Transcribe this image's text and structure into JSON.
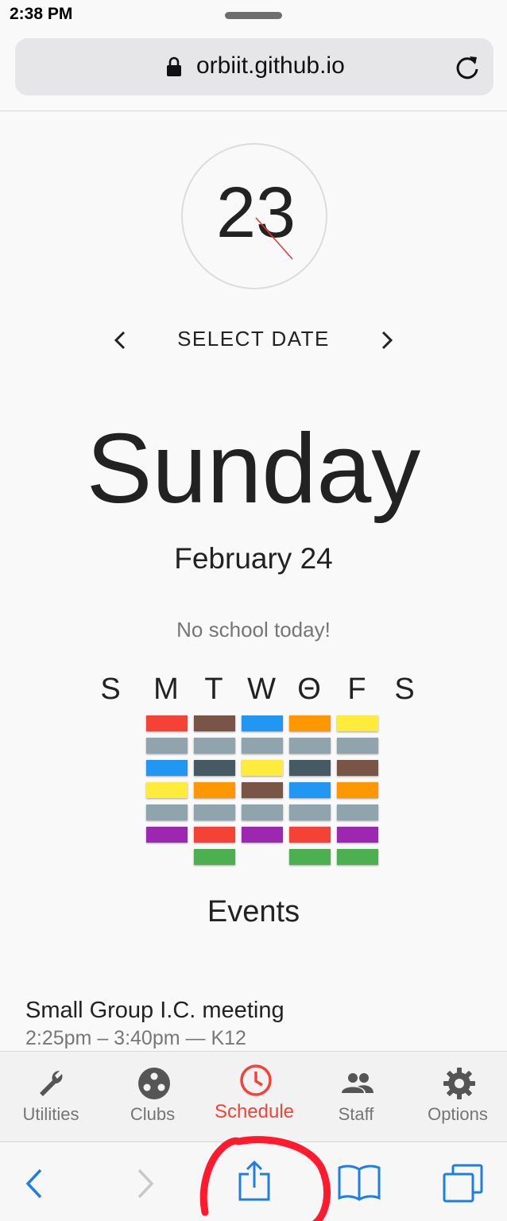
{
  "status": {
    "time": "2:38 PM"
  },
  "browser": {
    "url": "orbiit.github.io"
  },
  "countdown": {
    "value": "23"
  },
  "date_nav": {
    "label": "SELECT DATE"
  },
  "day": {
    "name": "Sunday",
    "date": "February 24",
    "notice": "No school today!"
  },
  "week": {
    "letters": [
      "S",
      "M",
      "T",
      "W",
      "Θ",
      "F",
      "S"
    ],
    "columns": [
      {
        "day": "M",
        "blocks": [
          "#f44336",
          "#90a4ae",
          "#2196f3",
          "#ffeb3b",
          "#90a4ae",
          "#9c27b0"
        ]
      },
      {
        "day": "T",
        "blocks": [
          "#795548",
          "#90a4ae",
          "#455a64",
          "#ff9800",
          "#90a4ae",
          "#f44336",
          "#4caf50"
        ]
      },
      {
        "day": "W",
        "blocks": [
          "#2196f3",
          "#90a4ae",
          "#ffeb3b",
          "#795548",
          "#90a4ae",
          "#9c27b0"
        ]
      },
      {
        "day": "Θ",
        "blocks": [
          "#ff9800",
          "#90a4ae",
          "#455a64",
          "#2196f3",
          "#90a4ae",
          "#f44336",
          "#4caf50"
        ]
      },
      {
        "day": "F",
        "blocks": [
          "#ffeb3b",
          "#90a4ae",
          "#795548",
          "#ff9800",
          "#90a4ae",
          "#9c27b0",
          "#4caf50"
        ]
      }
    ]
  },
  "events": {
    "title": "Events",
    "items": [
      {
        "name": "Small Group I.C. meeting",
        "time": "2:25pm – 3:40pm — K12"
      }
    ]
  },
  "app_tabs": [
    {
      "label": "Utilities",
      "icon": "wrench-icon",
      "active": false
    },
    {
      "label": "Clubs",
      "icon": "clubs-icon",
      "active": false
    },
    {
      "label": "Schedule",
      "icon": "clock-icon",
      "active": true
    },
    {
      "label": "Staff",
      "icon": "people-icon",
      "active": false
    },
    {
      "label": "Options",
      "icon": "gear-icon",
      "active": false
    }
  ],
  "colors": {
    "accent": "#f44336",
    "ios_blue": "#1e7fe0",
    "highlight": "#ff1a2e"
  }
}
